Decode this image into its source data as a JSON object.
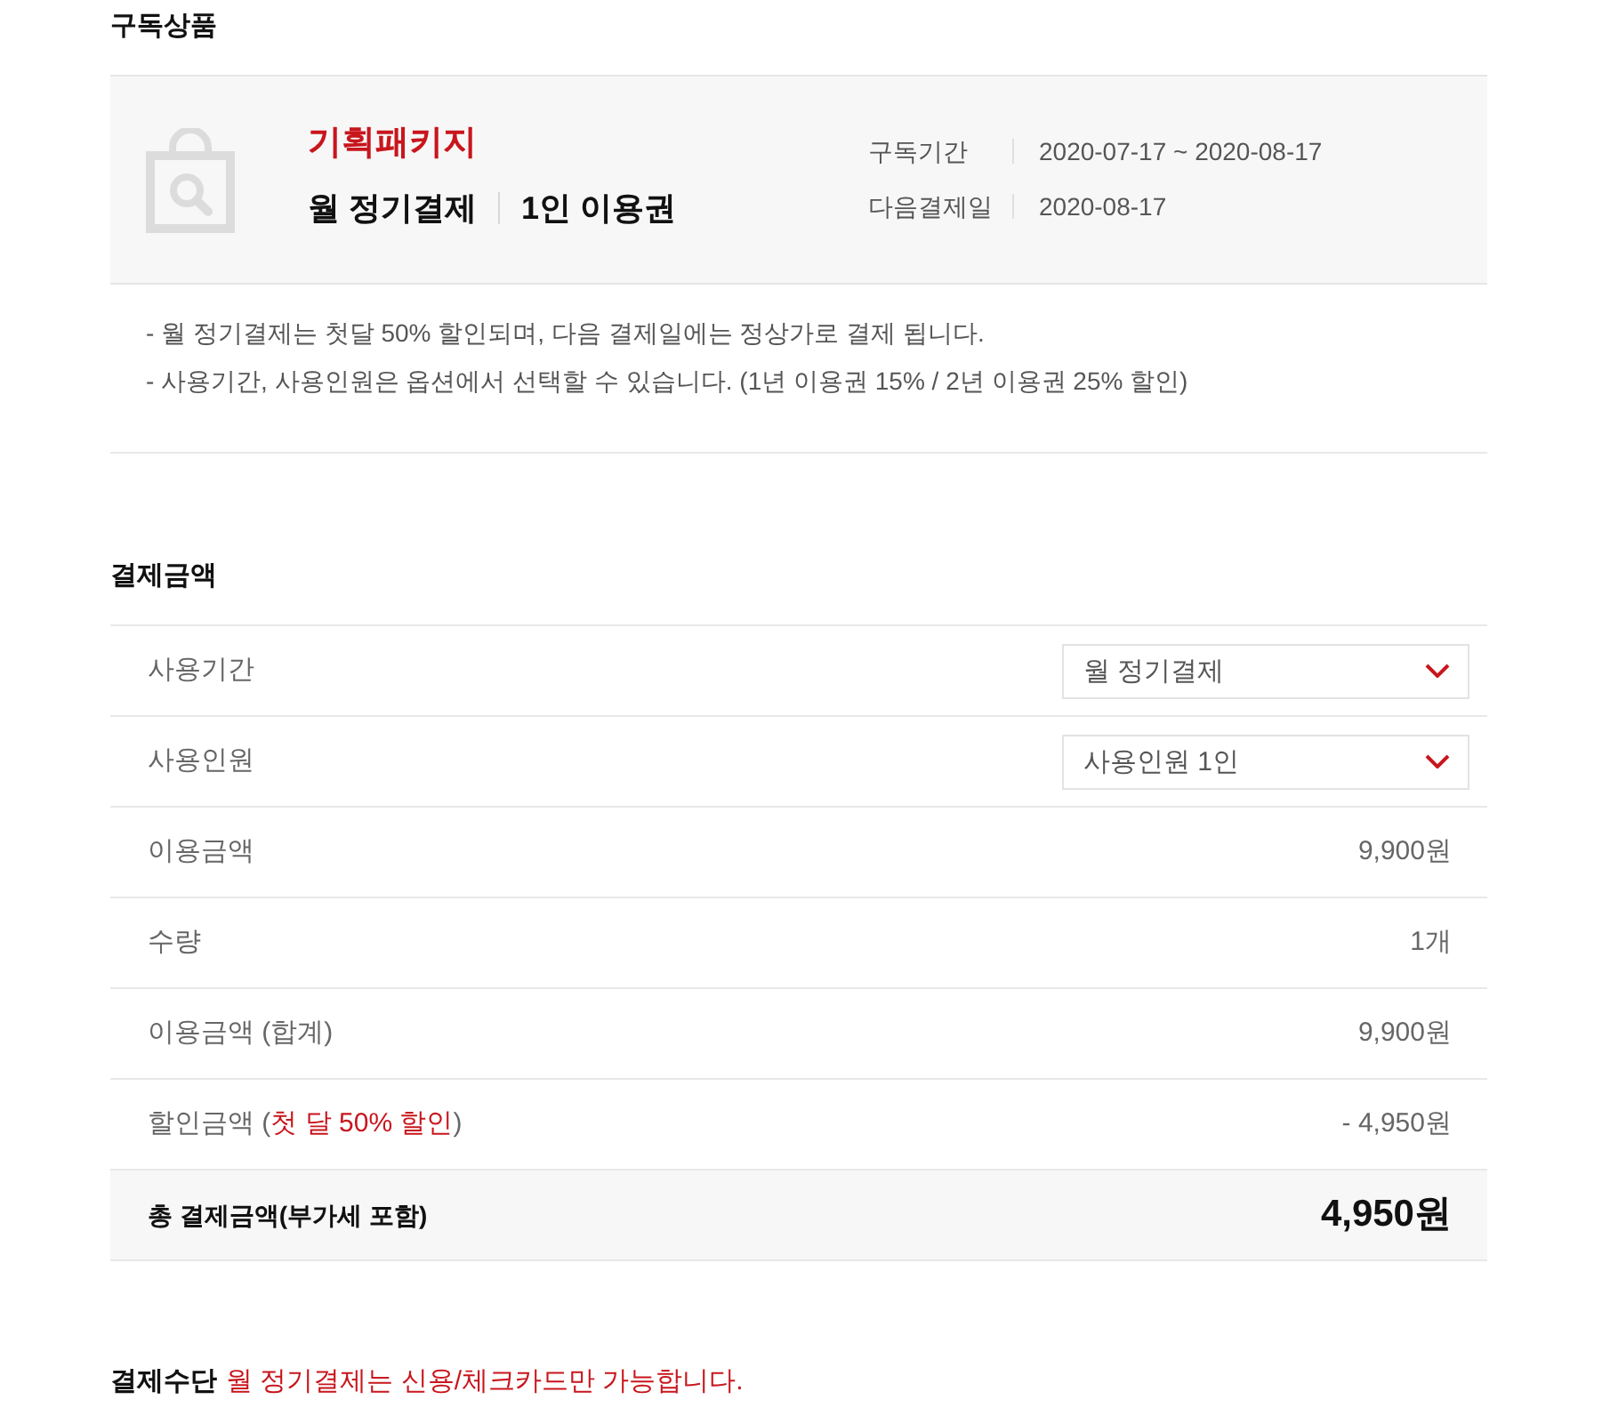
{
  "product_section": {
    "title": "구독상품",
    "product": {
      "name": "기획패키지",
      "plan": "월 정기결제",
      "option": "1인 이용권",
      "details": [
        {
          "label": "구독기간",
          "value": "2020-07-17 ~ 2020-08-17"
        },
        {
          "label": "다음결제일",
          "value": "2020-08-17"
        }
      ]
    },
    "notes": [
      "- 월 정기결제는 첫달 50% 할인되며, 다음 결제일에는 정상가로 결제 됩니다.",
      "- 사용기간, 사용인원은 옵션에서 선택할 수 있습니다. (1년 이용권 15% / 2년 이용권 25% 할인)"
    ]
  },
  "payment_section": {
    "title": "결제금액",
    "rows": [
      {
        "kind": "select",
        "label": "사용기간",
        "value": "월 정기결제"
      },
      {
        "kind": "select",
        "label": "사용인원",
        "value": "사용인원 1인"
      },
      {
        "kind": "amount",
        "label": "이용금액",
        "value": "9,900원"
      },
      {
        "kind": "amount",
        "label": "수량",
        "value": "1개"
      },
      {
        "kind": "amount",
        "label": "이용금액 (합계)",
        "value": "9,900원"
      },
      {
        "kind": "amount",
        "label": "할인금액 (*첫 달 50% 할인*)",
        "value": "- 4,950원"
      },
      {
        "kind": "total",
        "label": "총 결제금액(부가세 포함)",
        "value": "4,950원"
      }
    ]
  },
  "payment_method": {
    "title": "결제수단",
    "note": "월 정기결제는 신용/체크카드만 가능합니다."
  }
}
